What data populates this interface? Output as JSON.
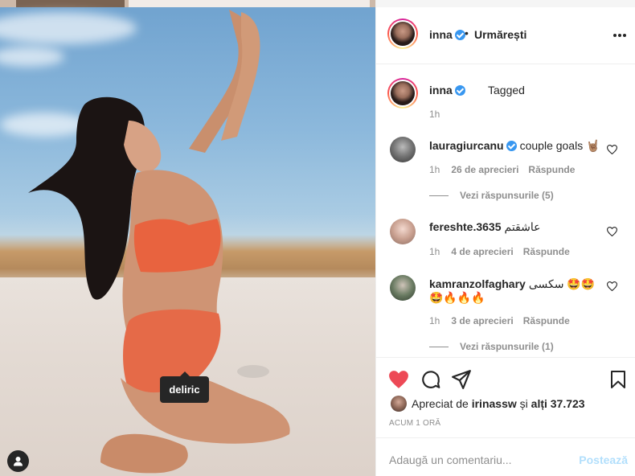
{
  "post": {
    "photo_tag": "deliric"
  },
  "header": {
    "username": "inna",
    "dot": "•",
    "follow_label": "Urmărești"
  },
  "caption": {
    "username": "inna",
    "text": "Tagged",
    "time": "1h"
  },
  "comments": [
    {
      "username": "lauragiurcanu",
      "verified": true,
      "text": "couple goals 🤘🏽",
      "time": "1h",
      "likes": "26 de aprecieri",
      "reply_label": "Răspunde",
      "view_replies": "Vezi răspunsurile (5)"
    },
    {
      "username": "fereshte.3635",
      "verified": false,
      "text": "عاشقتم",
      "time": "1h",
      "likes": "4 de aprecieri",
      "reply_label": "Răspunde"
    },
    {
      "username": "kamranzolfaghary",
      "verified": false,
      "text": "سکسی 🤩🤩",
      "text2": "🤩🔥🔥🔥",
      "time": "1h",
      "likes": "3 de aprecieri",
      "reply_label": "Răspunde",
      "view_replies": "Vezi răspunsurile (1)"
    }
  ],
  "likes": {
    "prefix": "Apreciat de",
    "user": "irinassw",
    "mid": "și",
    "others": "alți 37.723"
  },
  "time_ago": "ACUM 1 ORĂ",
  "add_comment": {
    "placeholder": "Adaugă un comentariu...",
    "post_label": "Postează"
  },
  "colors": {
    "verified": "#3897f0",
    "like_red": "#ed4956",
    "post_disabled": "#b2dffc"
  }
}
